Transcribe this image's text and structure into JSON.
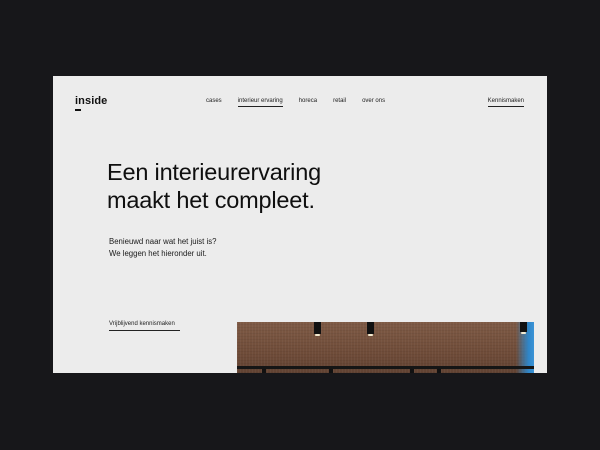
{
  "logo": {
    "text": "inside"
  },
  "nav": {
    "items": [
      {
        "label": "cases",
        "active": false
      },
      {
        "label": "interieur ervaring",
        "active": true
      },
      {
        "label": "horeca",
        "active": false
      },
      {
        "label": "retail",
        "active": false
      },
      {
        "label": "over ons",
        "active": false
      }
    ],
    "cta_label": "Kennismaken"
  },
  "hero": {
    "headline_line1": "Een interieurervaring",
    "headline_line2": "maakt het compleet.",
    "sub_line1": "Benieuwd naar wat het juist is?",
    "sub_line2": "We leggen het hieronder uit.",
    "cta_label": "Vrijblijvend kennismaken"
  },
  "colors": {
    "page_background": "#17171a",
    "frame_background": "#ececec",
    "text": "#0f0f0f",
    "ceiling": "#7e5a45",
    "accent_blue": "#2f86c9"
  }
}
